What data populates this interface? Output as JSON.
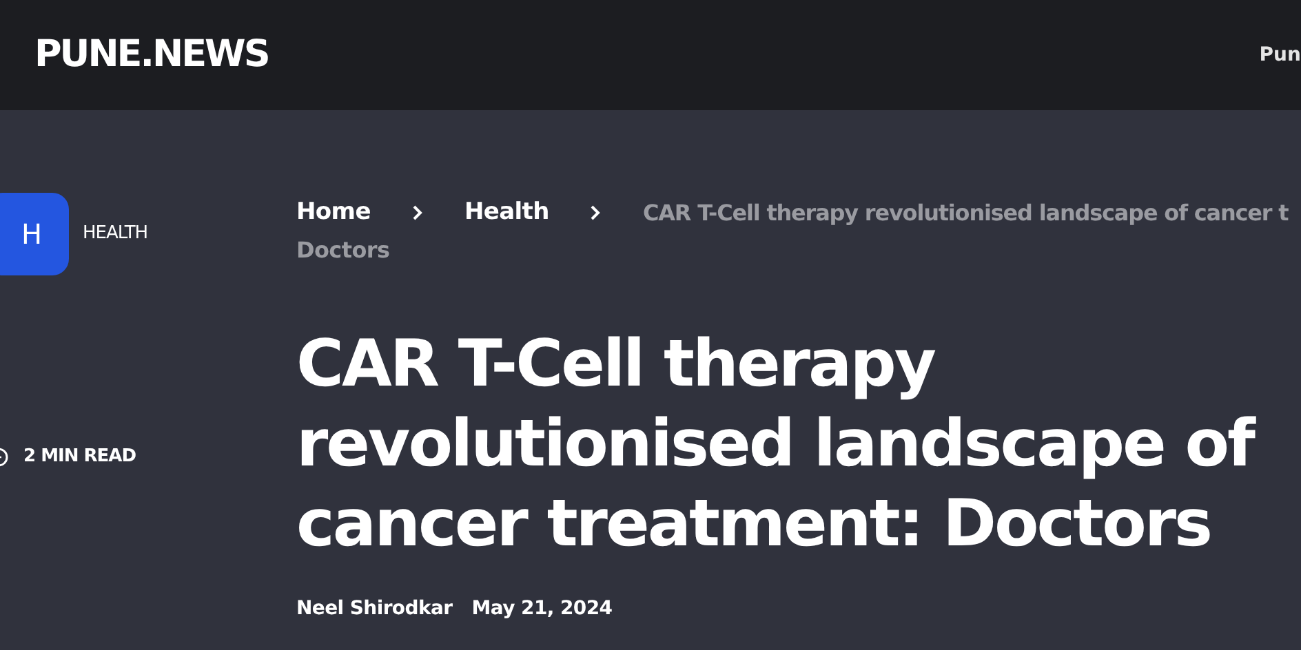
{
  "header": {
    "logo": "PUNE.NEWS",
    "nav": [
      "Pun"
    ]
  },
  "sidebar": {
    "category_badge": "H",
    "category": "HEALTH",
    "read_time": "2 MIN READ"
  },
  "breadcrumb": {
    "items": [
      "Home",
      "Health"
    ],
    "current": [
      "CAR T-Cell therapy revolutionised landscape of cancer t",
      "Doctors"
    ]
  },
  "article": {
    "title": "CAR T-Cell therapy revolutionised landscape of cancer treatment: Doctors",
    "author": "Neel Shirodkar",
    "date": "May 21, 2024"
  }
}
